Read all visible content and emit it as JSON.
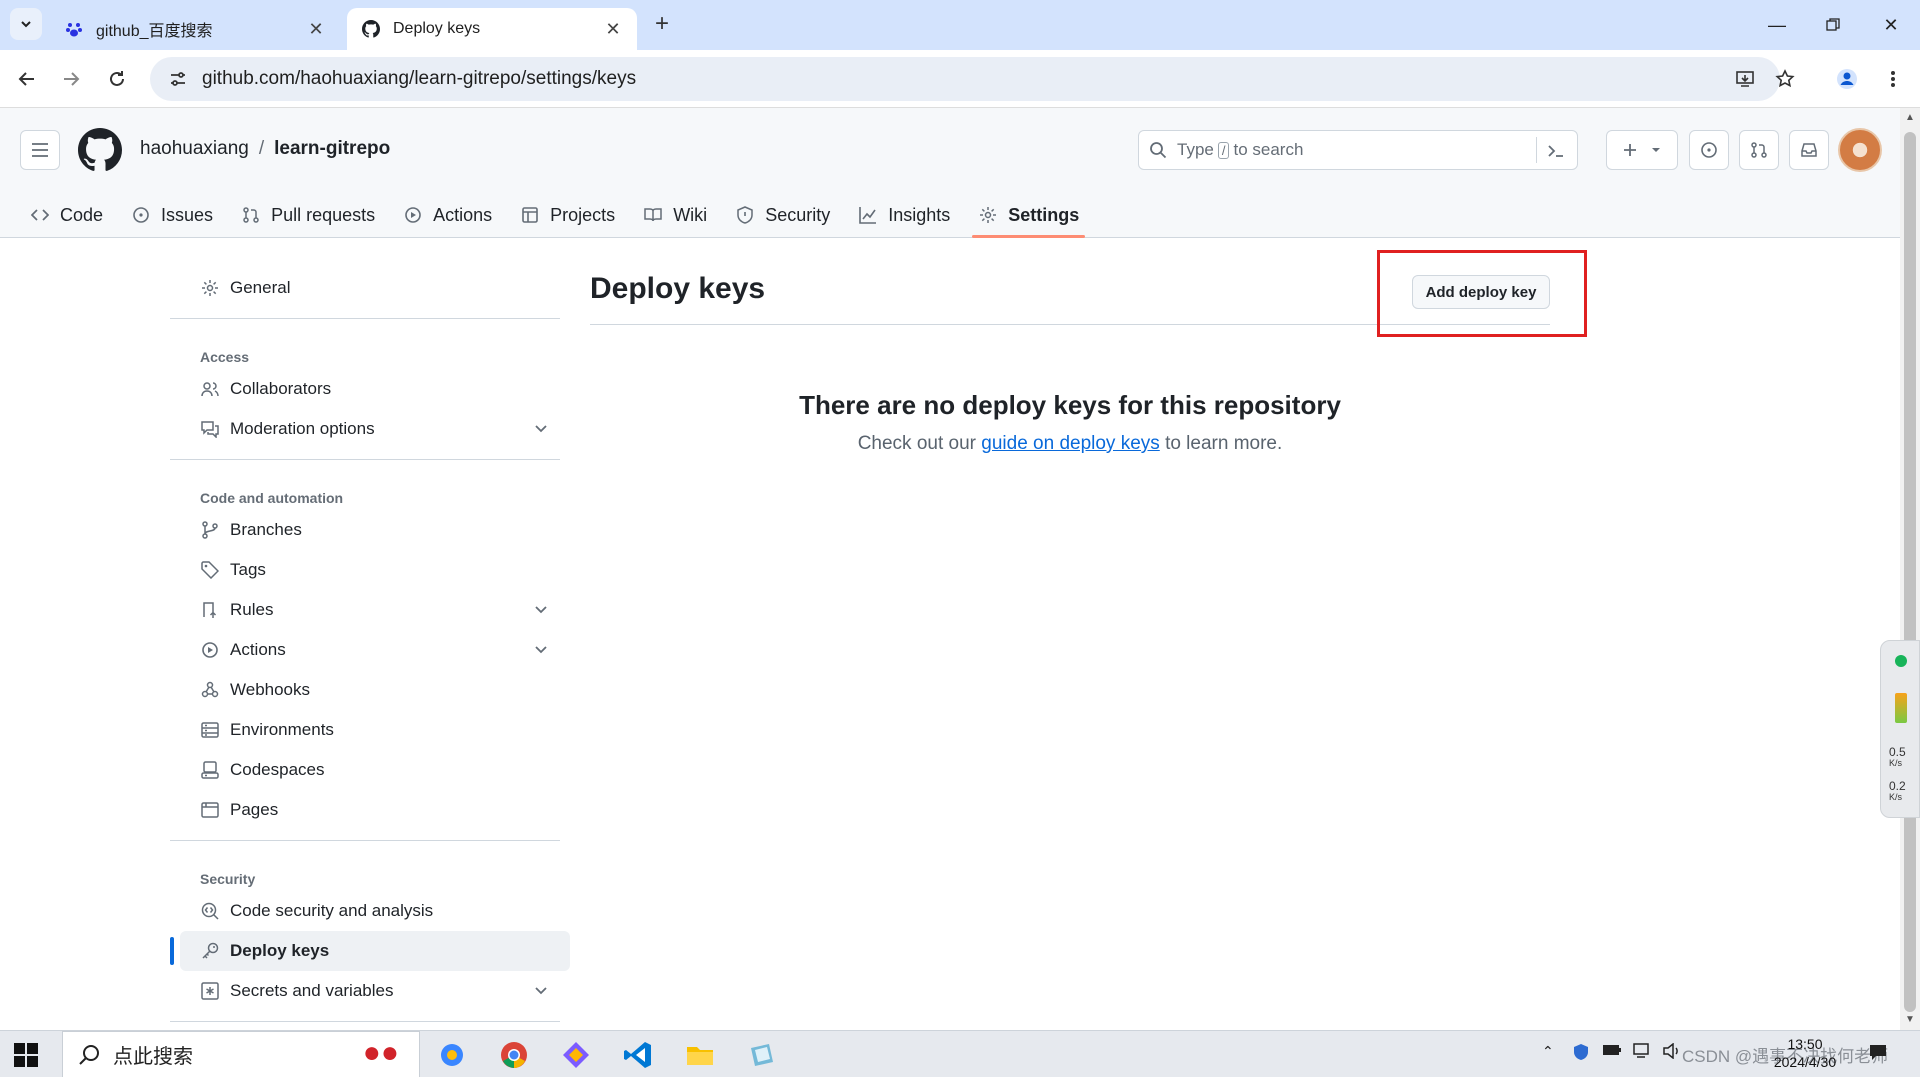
{
  "browser": {
    "tabs": [
      {
        "label": "github_百度搜索",
        "icon": "baidu-paw-icon",
        "active": false
      },
      {
        "label": "Deploy keys",
        "icon": "github-icon",
        "active": true
      }
    ],
    "url": "github.com/haohuaxiang/learn-gitrepo/settings/keys"
  },
  "header": {
    "owner": "haohuaxiang",
    "separator": "/",
    "repo": "learn-gitrepo",
    "search": {
      "prefix": "Type",
      "slash": "/",
      "suffix": "to search"
    }
  },
  "reponav": {
    "items": [
      {
        "label": "Code",
        "icon": "code-icon"
      },
      {
        "label": "Issues",
        "icon": "issue-icon"
      },
      {
        "label": "Pull requests",
        "icon": "pull-request-icon"
      },
      {
        "label": "Actions",
        "icon": "play-icon"
      },
      {
        "label": "Projects",
        "icon": "table-icon"
      },
      {
        "label": "Wiki",
        "icon": "book-icon"
      },
      {
        "label": "Security",
        "icon": "shield-icon"
      },
      {
        "label": "Insights",
        "icon": "graph-icon"
      },
      {
        "label": "Settings",
        "icon": "gear-icon",
        "selected": true
      }
    ]
  },
  "sidebar": {
    "general": "General",
    "groups": {
      "access": "Access",
      "code_automation": "Code and automation",
      "security": "Security"
    },
    "access_items": [
      "Collaborators",
      "Moderation options"
    ],
    "code_items": [
      "Branches",
      "Tags",
      "Rules",
      "Actions",
      "Webhooks",
      "Environments",
      "Codespaces",
      "Pages"
    ],
    "security_items": [
      "Code security and analysis",
      "Deploy keys",
      "Secrets and variables"
    ]
  },
  "main": {
    "title": "Deploy keys",
    "add_button": "Add deploy key",
    "blank_title": "There are no deploy keys for this repository",
    "blank_prefix": "Check out our",
    "blank_link": "guide on deploy keys",
    "blank_suffix": "to learn more."
  },
  "netwidget": {
    "up": "0.5",
    "down": "0.2",
    "unit": "K/s"
  },
  "taskbar": {
    "search_placeholder": "点此搜索",
    "time": "13:50",
    "date": "2024/4/30",
    "watermark": "CSDN @遇事不决找何老师"
  },
  "colors": {
    "accent": "#0969da",
    "selected_underline": "#fd8c73",
    "highlight": "#e02020"
  }
}
